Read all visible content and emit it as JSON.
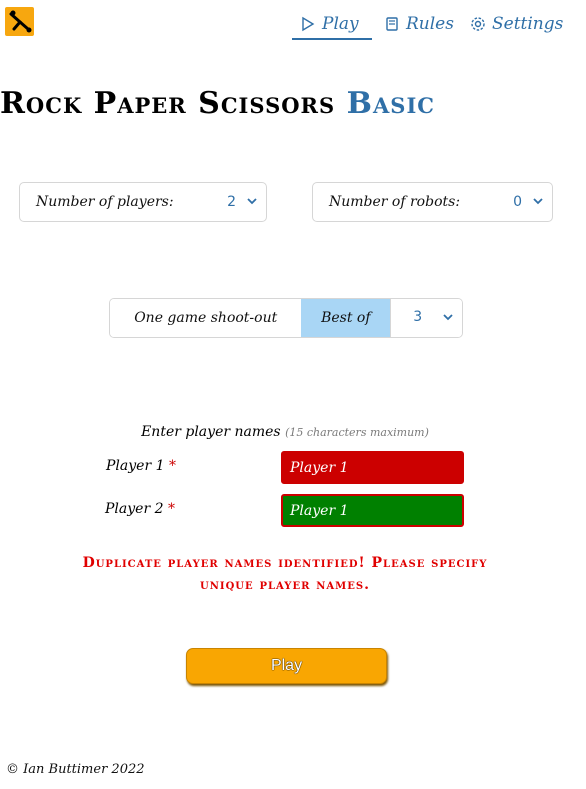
{
  "nav": {
    "play": "Play",
    "rules": "Rules",
    "settings": "Settings"
  },
  "title": {
    "main": "Rock Paper Scissors",
    "variant": "Basic"
  },
  "players_select": {
    "label": "Number of players:",
    "value": "2"
  },
  "robots_select": {
    "label": "Number of robots:",
    "value": "0"
  },
  "game_mode": {
    "shootout": "One game shoot-out",
    "best_of": "Best of",
    "best_of_value": "3",
    "selected": "best_of"
  },
  "names": {
    "heading": "Enter player names",
    "hint": "(15 characters maximum)",
    "players": [
      {
        "label": "Player 1",
        "value": "Player 1",
        "color": "#cc0000"
      },
      {
        "label": "Player 2",
        "value": "Player 1",
        "color": "#008000"
      }
    ]
  },
  "error": {
    "line1": "Duplicate player names identified! Please specify",
    "line2": "unique player names."
  },
  "play_button": "Play",
  "footer": "© Ian Buttimer 2022",
  "colors": {
    "accent": "#2f6fa7",
    "selected_mode": "#a9d6f5",
    "error": "#e00000",
    "play_button": "#f9a602"
  }
}
